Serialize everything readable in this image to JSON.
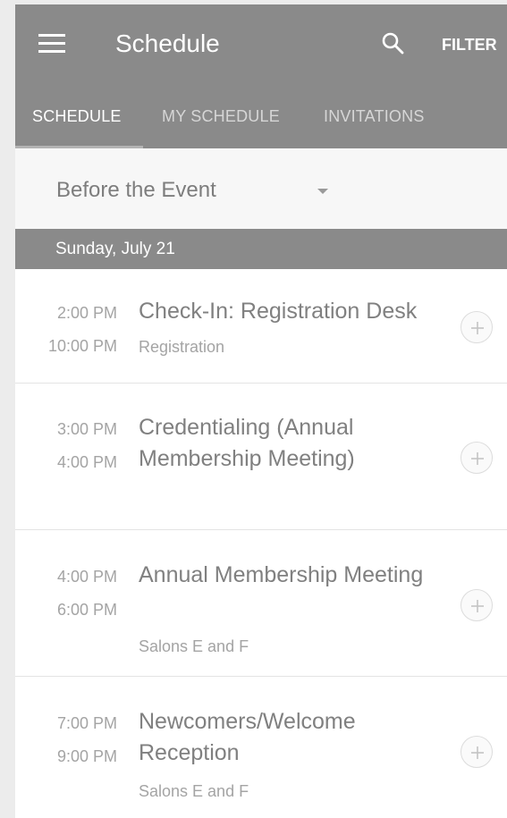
{
  "header": {
    "title": "Schedule",
    "filter_label": "FILTER",
    "menu_icon": "menu-icon",
    "search_icon": "search-icon"
  },
  "tabs": [
    {
      "label": "SCHEDULE",
      "active": true
    },
    {
      "label": "MY SCHEDULE",
      "active": false
    },
    {
      "label": "INVITATIONS",
      "active": false
    }
  ],
  "dropdown": {
    "selected": "Before the Event"
  },
  "day": {
    "label": "Sunday, July 21"
  },
  "sessions": [
    {
      "start": "2:00 PM",
      "end": "10:00 PM",
      "title": "Check-In: Registration Desk",
      "location": "Registration"
    },
    {
      "start": "3:00 PM",
      "end": "4:00 PM",
      "title": "Credentialing (Annual Membership Meeting)",
      "location": ""
    },
    {
      "start": "4:00 PM",
      "end": "6:00 PM",
      "title": "Annual Membership Meeting",
      "location": "Salons E and F"
    },
    {
      "start": "7:00 PM",
      "end": "9:00 PM",
      "title": "Newcomers/Welcome Reception",
      "location": "Salons E and F"
    }
  ],
  "colors": {
    "appbar": "#8a8a8a",
    "text_muted": "#a4a4a4",
    "title_text": "#808080"
  }
}
